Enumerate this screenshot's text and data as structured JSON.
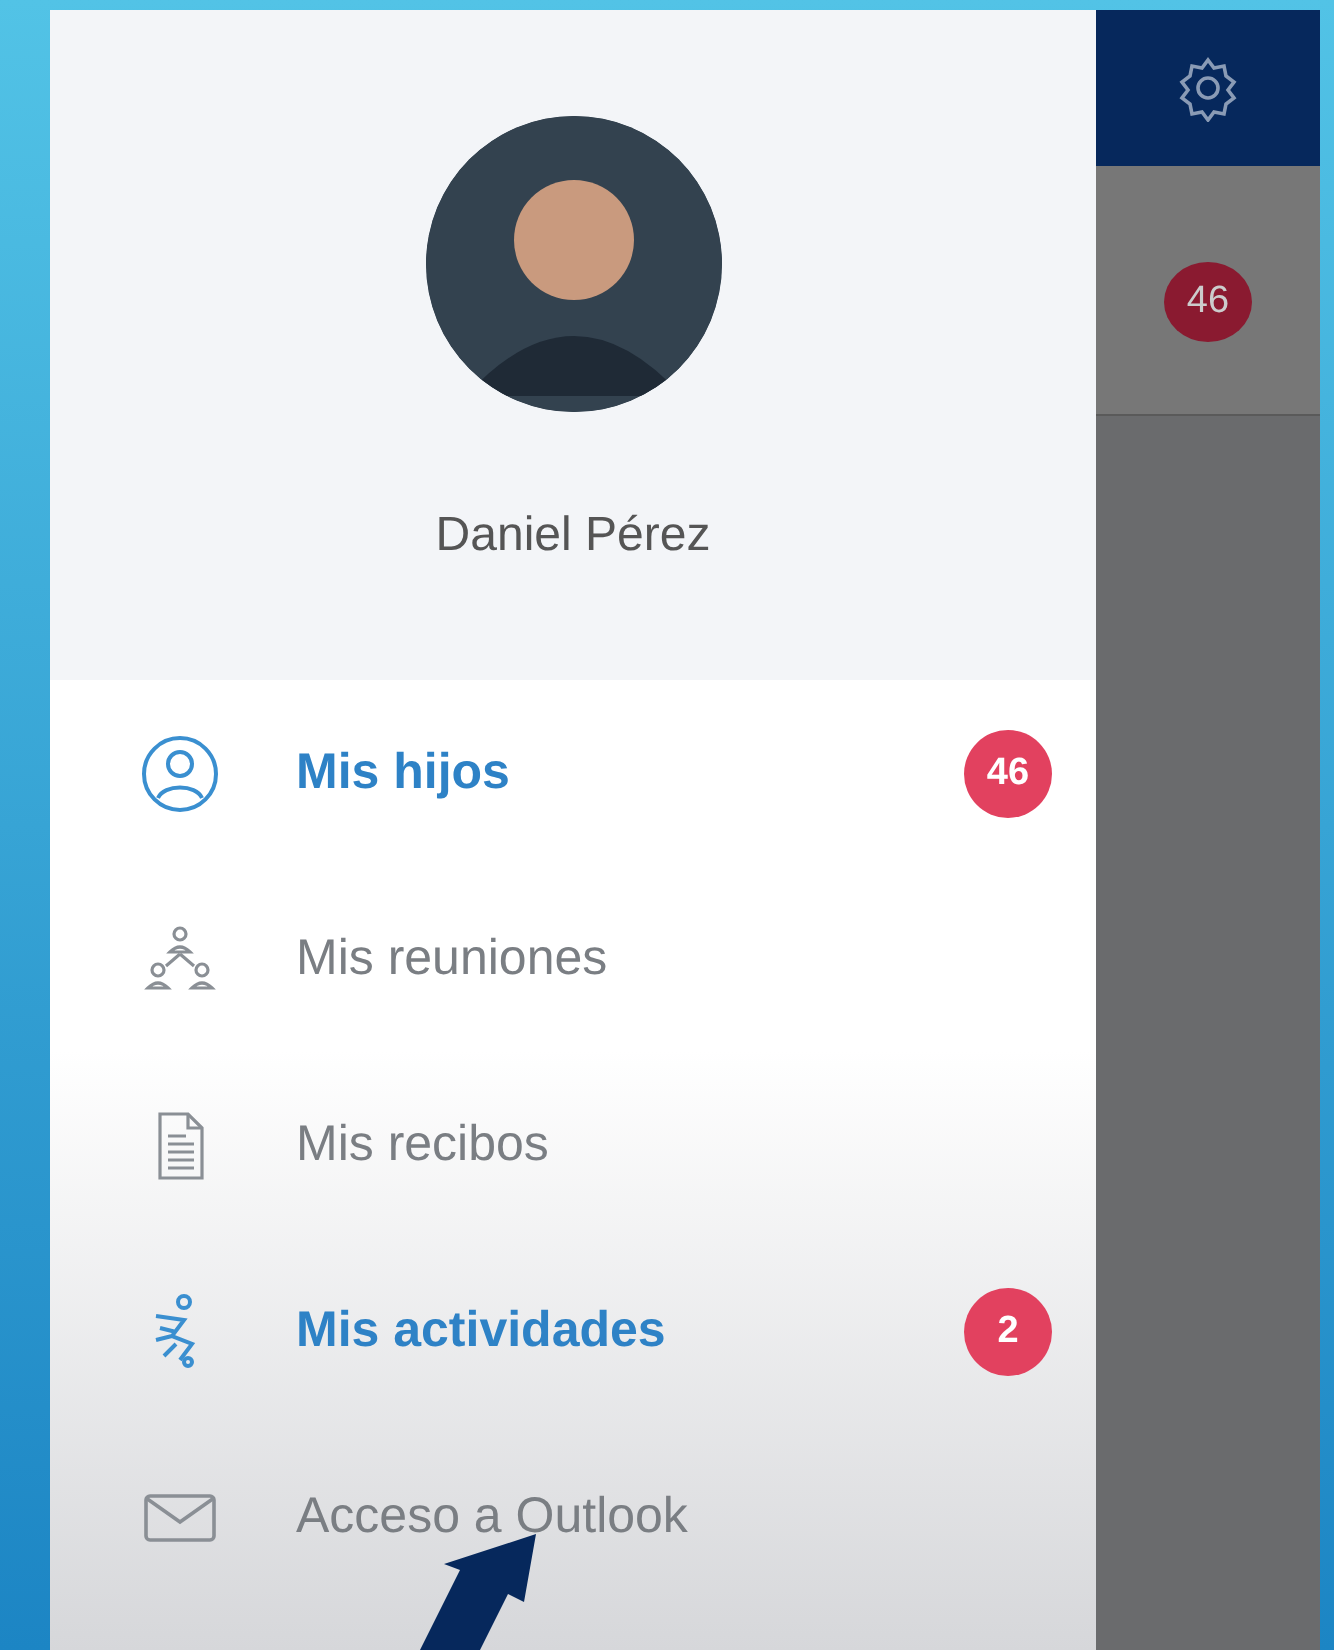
{
  "profile": {
    "name": "Daniel Pérez"
  },
  "menu": [
    {
      "label": "Mis hijos",
      "active": true,
      "badge": "46"
    },
    {
      "label": "Mis reuniones",
      "active": false
    },
    {
      "label": "Mis recibos",
      "active": false
    },
    {
      "label": "Mis actividades",
      "active": true,
      "badge": "2"
    },
    {
      "label": "Acceso a Outlook",
      "active": false
    }
  ],
  "background_screen": {
    "badge": "46"
  }
}
